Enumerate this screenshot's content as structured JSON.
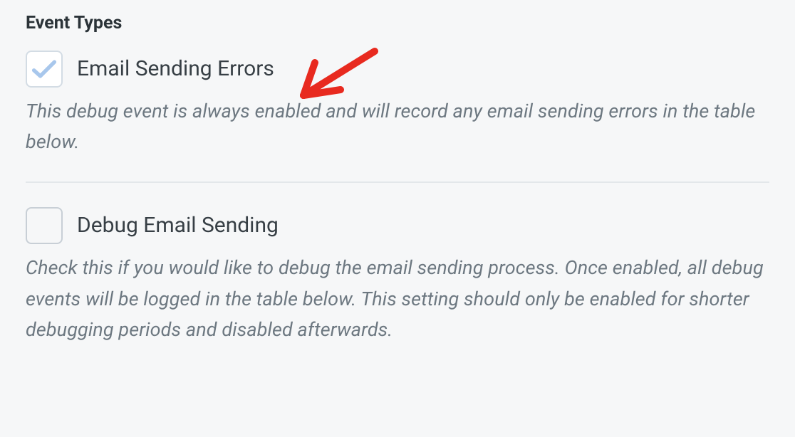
{
  "section": {
    "title": "Event Types"
  },
  "options": {
    "emailErrors": {
      "label": "Email Sending Errors",
      "description": "This debug event is always enabled and will record any email sending errors in the table below.",
      "checked": true
    },
    "debugSending": {
      "label": "Debug Email Sending",
      "description": "Check this if you would like to debug the email sending process. Once enabled, all debug events will be logged in the table below. This setting should only be enabled for shorter debugging periods and disabled afterwards.",
      "checked": false
    }
  },
  "annotation": {
    "color": "#e82a1f"
  }
}
